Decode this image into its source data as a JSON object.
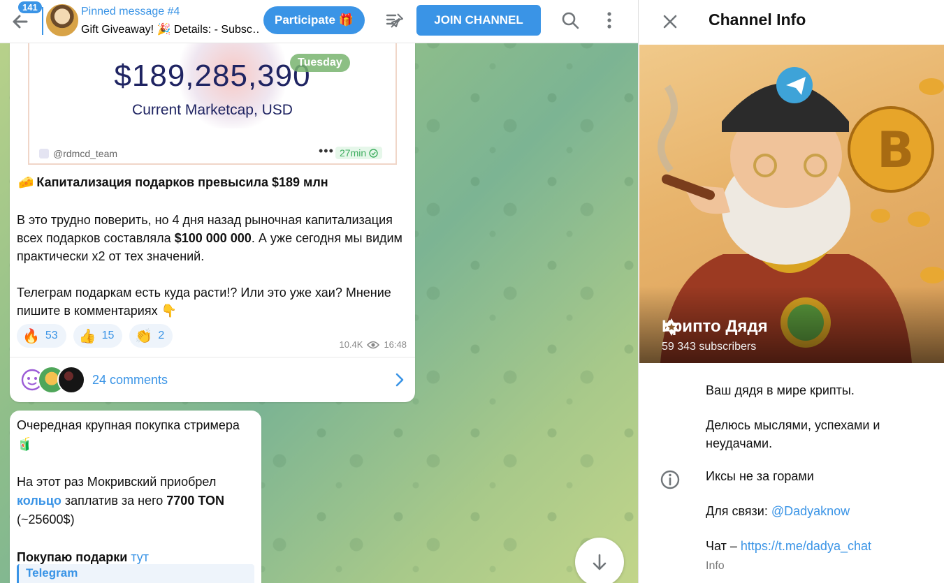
{
  "header": {
    "unread_count": "141",
    "pinned_title": "Pinned message #4",
    "pinned_text": "Gift Giveaway! 🎉 Details: - Subsc…",
    "participate_label": "Participate 🎁",
    "join_label": "JOIN CHANNEL"
  },
  "message1": {
    "embed": {
      "market_value": "$189,285,390",
      "market_label": "Current Marketcap, USD",
      "handle": "@rdmcd_team",
      "dots": "•••",
      "time": "27min"
    },
    "date_pill": "Tuesday",
    "title_emoji": "🧀",
    "title": "Капитализация подарков превысила $189 млн",
    "p1_pre": "В это трудно поверить, но 4 дня назад рыночная капитализация всех подарков составляла ",
    "p1_bold": "$100 000 000",
    "p1_post": ". А уже сегодня мы видим практически x2 от тех значений.",
    "p2": "Телеграм подаркам есть куда расти!? Или это уже хаи? Мнение пишите в комментариях 👇",
    "reactions": [
      {
        "emoji": "🔥",
        "count": "53"
      },
      {
        "emoji": "👍",
        "count": "15"
      },
      {
        "emoji": "👏",
        "count": "2"
      }
    ],
    "views": "10.4K",
    "time": "16:48",
    "comments": "24 comments"
  },
  "message2": {
    "line1": "Очередная крупная покупка стримера 🧃",
    "p2_pre": "На этот раз Мокривский  приобрел ",
    "p2_link": "кольцо",
    "p2_mid": " заплатив за него ",
    "p2_bold": "7700 TON",
    "p2_post": " (~25600$)",
    "p3_pre": "Покупаю подарки ",
    "p3_link": "тут",
    "preview_label": "Telegram"
  },
  "info_panel": {
    "title": "Channel Info",
    "channel_name": "Крипто Дядя",
    "subscribers": "59 343 subscribers",
    "desc1": "Ваш дядя в мире крипты.",
    "desc2": "Делюсь мыслями, успехами и неудачами.",
    "line1": "Иксы не за горами",
    "line2_pre": "Для связи: ",
    "line2_link": "@Dadyaknow",
    "line3_pre": "Чат – ",
    "line3_link": "https://t.me/dadya_chat",
    "caption": "Info"
  },
  "colors": {
    "accent": "#3a94e6",
    "reaction_bg": "#eef4fb"
  }
}
